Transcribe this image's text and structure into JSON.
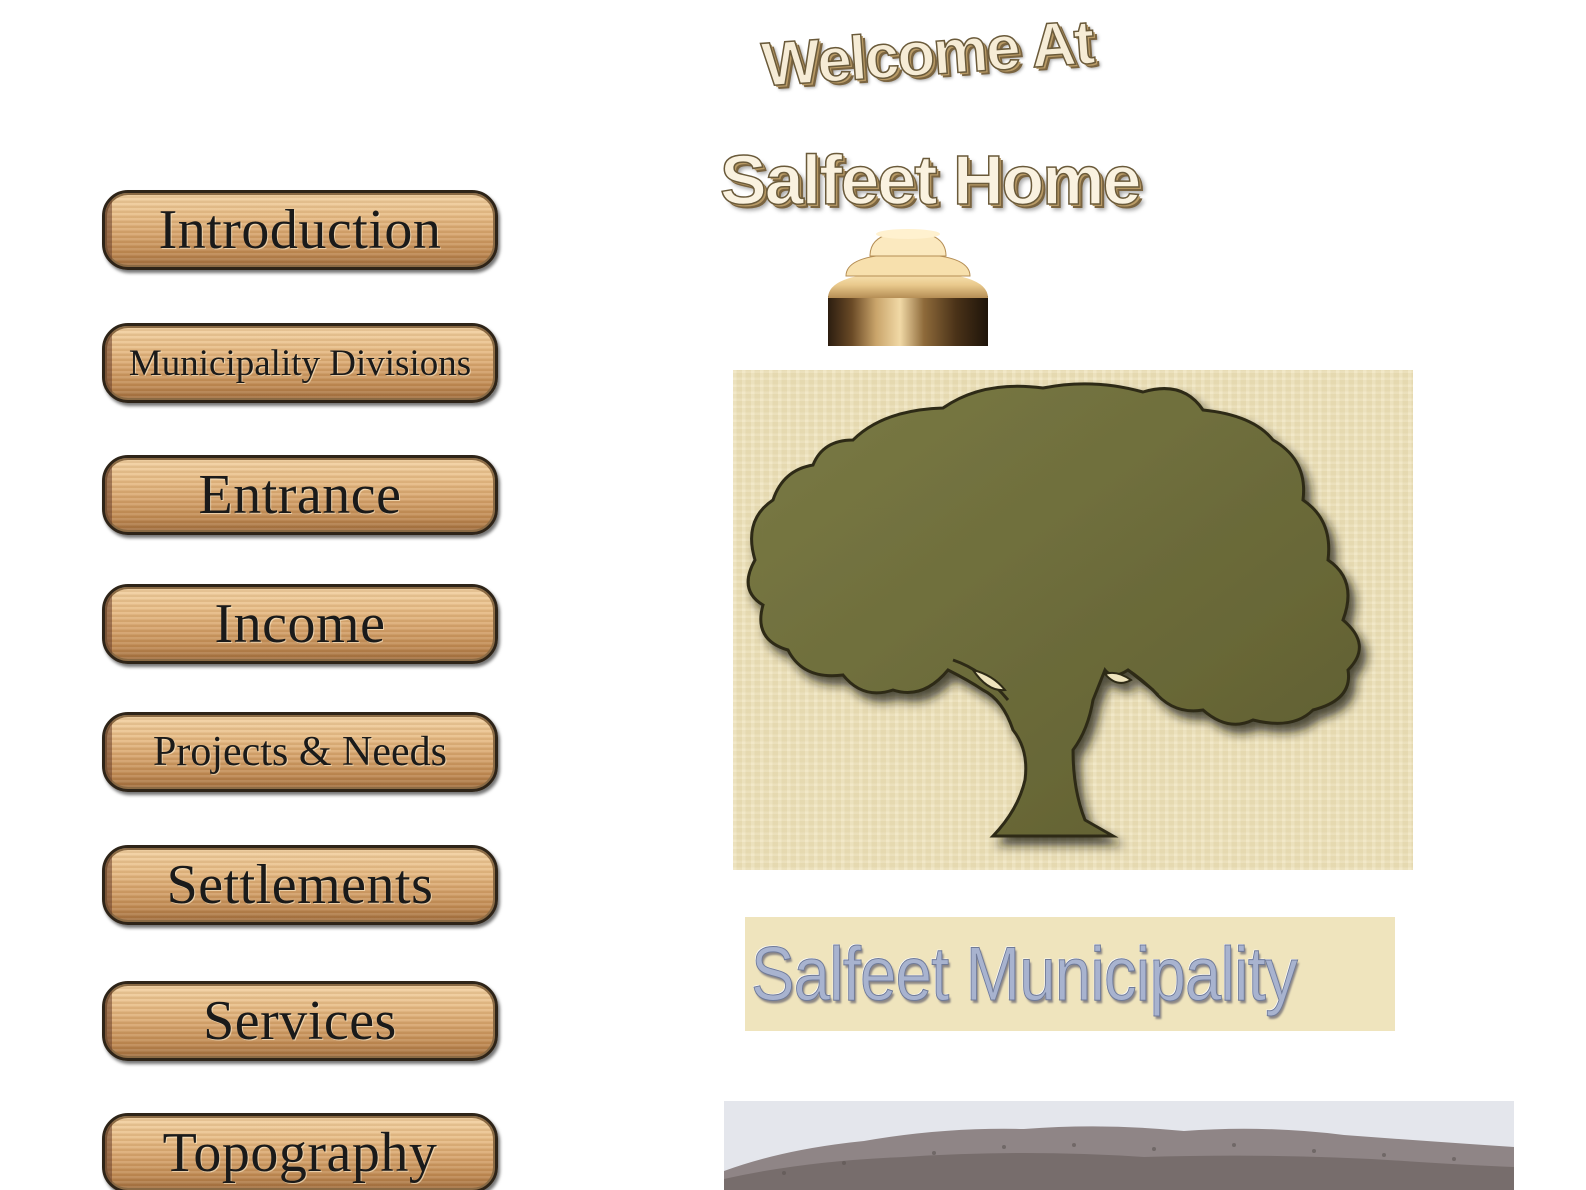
{
  "nav": {
    "items": [
      {
        "label": "Introduction"
      },
      {
        "label": "Municipality Divisions"
      },
      {
        "label": "Entrance"
      },
      {
        "label": "Income"
      },
      {
        "label": "Projects & Needs"
      },
      {
        "label": "Settlements"
      },
      {
        "label": "Services"
      },
      {
        "label": "Topography"
      }
    ]
  },
  "header": {
    "welcome": "Welcome At",
    "title": "Salfeet Home"
  },
  "logo": {
    "icon": "olive-tree-icon",
    "tree_color": "#6b6a3a",
    "background_color": "#efe4bd"
  },
  "banner": {
    "text": "Salfeet Municipality",
    "text_color": "#a8b3cf"
  },
  "colors": {
    "wood_light": "#f3d3a4",
    "wood_dark": "#9e6b3b",
    "border": "#2e2418"
  }
}
